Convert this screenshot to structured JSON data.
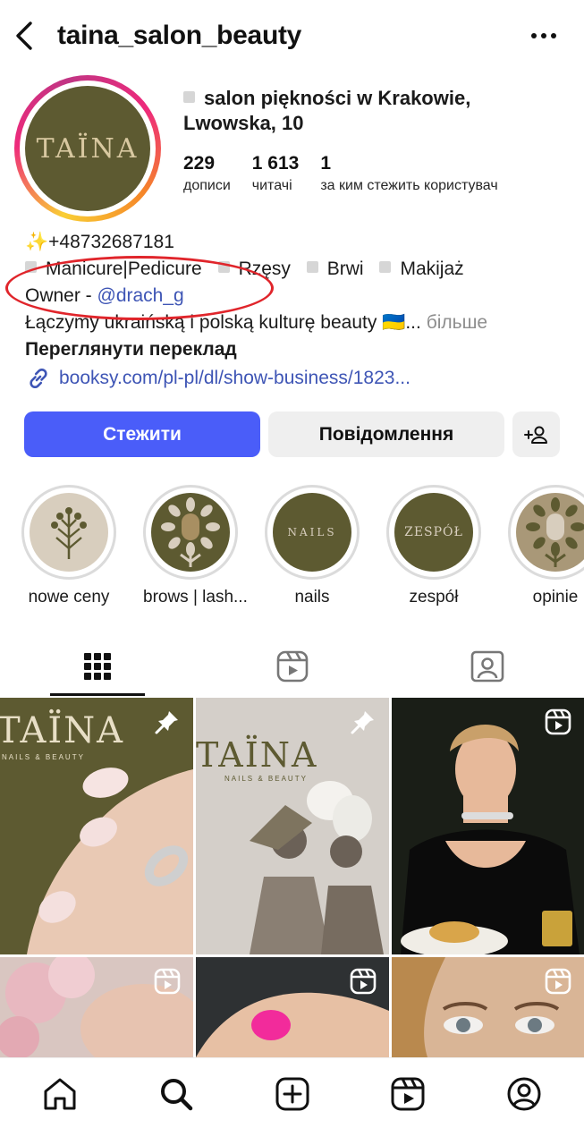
{
  "header": {
    "username": "taina_salon_beauty",
    "back_icon": "chevron-left-icon",
    "more_icon": "more-horizontal-icon"
  },
  "profile": {
    "avatar_text": "TAÏNA",
    "category": "salon piękności w Krakowie, Lwowska, 10",
    "stats": [
      {
        "value": "229",
        "label": "дописи"
      },
      {
        "value": "1 613",
        "label": "читачі"
      },
      {
        "value": "1",
        "label": "за ким стежить користувач"
      }
    ]
  },
  "bio": {
    "phone": "✨+48732687181",
    "services": [
      "Manicure|Pedicure",
      "Rzęsy",
      "Brwi",
      "Makijaż"
    ],
    "owner_prefix": "Owner - ",
    "owner_mention": "@drach_g",
    "tagline": "Łączymy ukraińską i polską kulturę beauty 🇺🇦...",
    "more_label": "більше",
    "translate_label": "Переглянути переклад",
    "link": "booksy.com/pl-pl/dl/show-business/1823..."
  },
  "buttons": {
    "follow": "Стежити",
    "message": "Повідомлення",
    "add_user_icon": "add-user-icon"
  },
  "highlights": [
    {
      "label": "nowe ceny",
      "art": "branch"
    },
    {
      "label": "brows | lash...",
      "art": "sunflower"
    },
    {
      "label": "nails",
      "art_text": "NAILS"
    },
    {
      "label": "zespół",
      "art_text": "ZESPÓŁ"
    },
    {
      "label": "opinie",
      "art": "sunflower"
    }
  ],
  "tabs": [
    {
      "name": "grid",
      "icon": "grid-icon",
      "active": true
    },
    {
      "name": "reels",
      "icon": "reels-icon",
      "active": false
    },
    {
      "name": "tagged",
      "icon": "tagged-user-icon",
      "active": false
    }
  ],
  "grid_posts": [
    {
      "badge": "pin-icon",
      "brand_text": "TAÏNA",
      "brand_sub": "NAILS & BEAUTY"
    },
    {
      "badge": "pin-icon",
      "brand_text": "TAÏNA",
      "brand_sub": "NAILS & BEAUTY"
    },
    {
      "badge": "reels-icon"
    },
    {
      "badge": "reels-icon"
    },
    {
      "badge": "reels-icon"
    },
    {
      "badge": "reels-icon"
    }
  ],
  "bottom_nav": [
    "home-icon",
    "search-icon",
    "create-icon",
    "reels-icon",
    "profile-icon"
  ],
  "colors": {
    "follow_button": "#4a5df9",
    "link": "#3e55b5",
    "brand_olive": "#5d5a31",
    "annotation_red": "#e0252b"
  }
}
